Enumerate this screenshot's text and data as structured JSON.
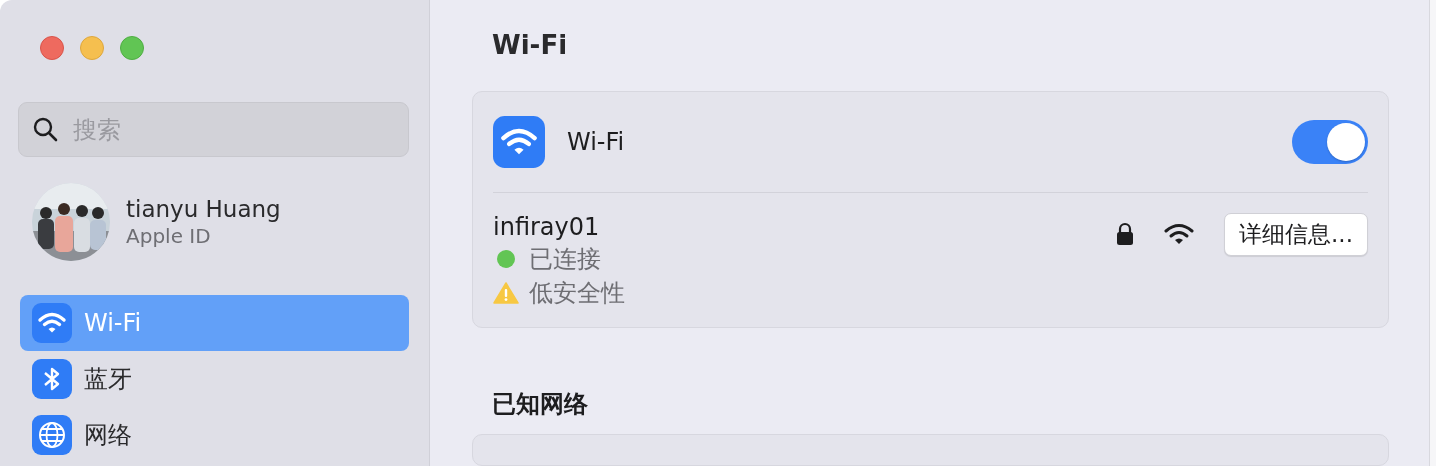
{
  "sidebar": {
    "search": {
      "placeholder": "搜索"
    },
    "account": {
      "name": "tianyu Huang",
      "subtitle": "Apple ID"
    },
    "items": [
      {
        "label": "Wi-Fi",
        "kind": "wifi",
        "selected": true
      },
      {
        "label": "蓝牙",
        "kind": "bluetooth",
        "selected": false
      },
      {
        "label": "网络",
        "kind": "globe",
        "selected": false
      }
    ]
  },
  "main": {
    "title": "Wi-Fi",
    "wifi": {
      "label": "Wi-Fi",
      "on": true
    },
    "network": {
      "name": "infiray01",
      "statuses": [
        {
          "kind": "dot",
          "text": "已连接",
          "color": "#62c554"
        },
        {
          "kind": "warning",
          "text": "低安全性"
        }
      ],
      "locked": true,
      "button": "详细信息..."
    },
    "known_networks": {
      "title": "已知网络"
    }
  }
}
